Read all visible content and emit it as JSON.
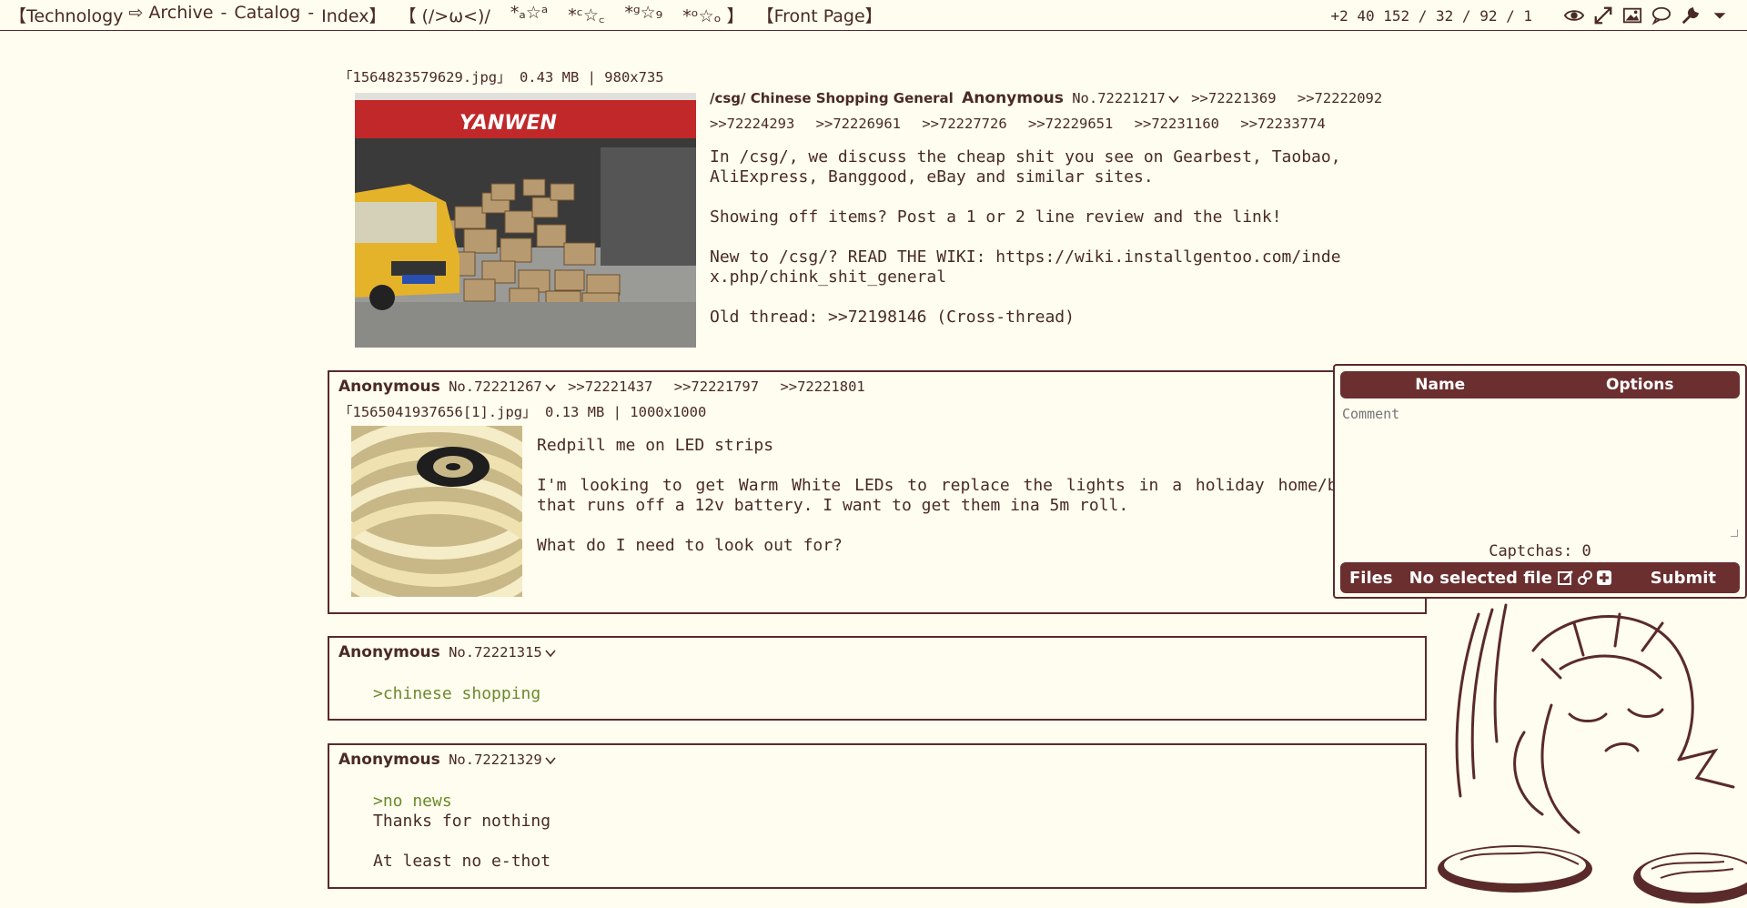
{
  "header": {
    "board": "【Technology",
    "arrow": "⇨",
    "archive": "Archive",
    "sep1": "-",
    "catalog": "Catalog",
    "sep2": "-",
    "index": "Index】",
    "deco1": "【 (/>ω<)/",
    "deco2": "*ₐ☆ᵃ",
    "deco3": "*ᶜ☆꜀",
    "deco4": "*ᵍ☆₉",
    "deco5": "*ᵒ☆ₒ 】",
    "frontpage": "【Front Page】",
    "counts": "+2 40 152 / 32 / 92 / 1",
    "icons": [
      "eye-icon",
      "expand-icon",
      "image-icon",
      "speech-bubble-icon",
      "wrench-icon",
      "chevron-down-icon"
    ]
  },
  "op": {
    "fileinfo": "「1564823579629.jpg」 0.43 MB | 980x735",
    "subject": "/csg/ Chinese Shopping General",
    "name": "Anonymous",
    "postno": "No.72221217",
    "backlinks_row1": [
      ">>72221369",
      ">>72222092"
    ],
    "backlinks_row2": [
      ">>72224293",
      ">>72226961",
      ">>72227726",
      ">>72229651",
      ">>72231160",
      ">>72233774"
    ],
    "body": [
      "In /csg/, we discuss the cheap shit you see on Gearbest, Taobao,\nAliExpress, Banggood, eBay and similar sites.",
      "Showing off items? Post a 1 or 2 line review and the link!",
      "New to /csg/? READ THE WIKI: https://wiki.installgentoo.com/inde\nx.php/chink_shit_general",
      "Old thread: >>72198146 (Cross-thread)"
    ],
    "sign_text": "YANWEN"
  },
  "replies": [
    {
      "name": "Anonymous",
      "postno": "No.72221267",
      "backlinks": [
        ">>72221437",
        ">>72221797",
        ">>72221801"
      ],
      "fileinfo": "「1565041937656[1].jpg」 0.13 MB | 1000x1000",
      "lines": [
        "Redpill me on LED strips",
        "I'm looking to get Warm White LEDs to replace the lights in a holiday home/b",
        "that runs off a 12v battery. I want to get them ina 5m roll.",
        "What do I need to look out for?"
      ]
    },
    {
      "name": "Anonymous",
      "postno": "No.72221315",
      "greentext": ">chinese shopping"
    },
    {
      "name": "Anonymous",
      "postno": "No.72221329",
      "greentext": ">no news",
      "line1": "Thanks for nothing",
      "line2": "At least no e-thot"
    }
  ],
  "quick_reply": {
    "name_label": "Name",
    "options_label": "Options",
    "comment_placeholder": "Comment",
    "captcha": "Captchas: 0",
    "files_label": "Files",
    "no_file": "No selected file",
    "submit": "Submit"
  },
  "colors": {
    "background": "#fefdf0",
    "text": "#4a2a24",
    "border": "#5a2a2a",
    "qr_bar": "#6b2f2f",
    "greentext": "#6b8a2a"
  }
}
